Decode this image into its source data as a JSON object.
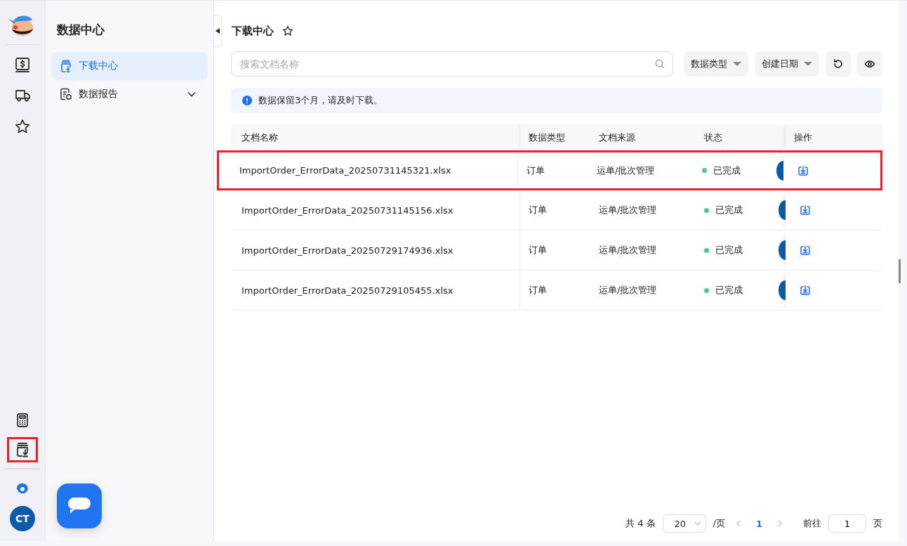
{
  "rail": {
    "items": [
      {
        "highlighted": false
      },
      {
        "highlighted": false
      },
      {
        "highlighted": false
      },
      {
        "highlighted": false
      },
      {
        "highlighted": true
      }
    ],
    "avatar": "CT"
  },
  "sidebar": {
    "title": "数据中心",
    "items": [
      {
        "label": "下载中心",
        "selected": true
      },
      {
        "label": "数据报告",
        "selected": false,
        "expanded": false
      }
    ]
  },
  "page": {
    "title": "下载中心",
    "favorite": false,
    "search": {
      "placeholder": "搜索文档名称"
    },
    "filters": [
      "数据类型",
      "创建日期"
    ],
    "notice": "数据保留3个月，请及时下载。"
  },
  "table": {
    "columns": [
      "文档名称",
      "数据类型",
      "文档来源",
      "状态",
      "操作"
    ],
    "rows": [
      {
        "name": "ImportOrder_ErrorData_20250731145321.xlsx",
        "type": "订单",
        "source": "运单/批次管理",
        "status": "已完成",
        "color": "#3ecf8e",
        "highlighted": true
      },
      {
        "name": "ImportOrder_ErrorData_20250731145156.xlsx",
        "type": "订单",
        "source": "运单/批次管理",
        "status": "已完成",
        "color": "#3ecf8e",
        "highlighted": false
      },
      {
        "name": "ImportOrder_ErrorData_20250729174936.xlsx",
        "type": "订单",
        "source": "运单/批次管理",
        "status": "已完成",
        "color": "#3ecf8e",
        "highlighted": false
      },
      {
        "name": "ImportOrder_ErrorData_20250729105455.xlsx",
        "type": "订单",
        "source": "运单/批次管理",
        "status": "已完成",
        "color": "#3ecf8e",
        "highlighted": false
      }
    ]
  },
  "pagination": {
    "total": "共 4 条",
    "page_size": "20",
    "per_page": "/页",
    "pages": [
      {
        "label": "1",
        "selected": true
      }
    ],
    "goto_label": "前往",
    "goto_value": "1",
    "goto_suffix": "页"
  }
}
